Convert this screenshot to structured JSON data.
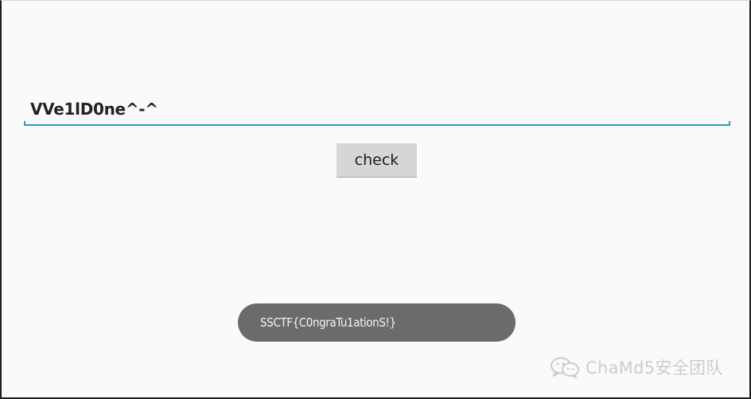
{
  "input": {
    "value": "VVe1lD0ne^-^"
  },
  "button": {
    "label": "check"
  },
  "toast": {
    "message": "SSCTF{C0ngraTu1ationS!}"
  },
  "watermark": {
    "text": "ChaMd5安全团队",
    "icon": "wechat-icon"
  },
  "colors": {
    "background": "#fafafa",
    "accent": "#2b9bc5",
    "button_bg": "#d6d6d6",
    "toast_bg": "#6b6b6b"
  }
}
